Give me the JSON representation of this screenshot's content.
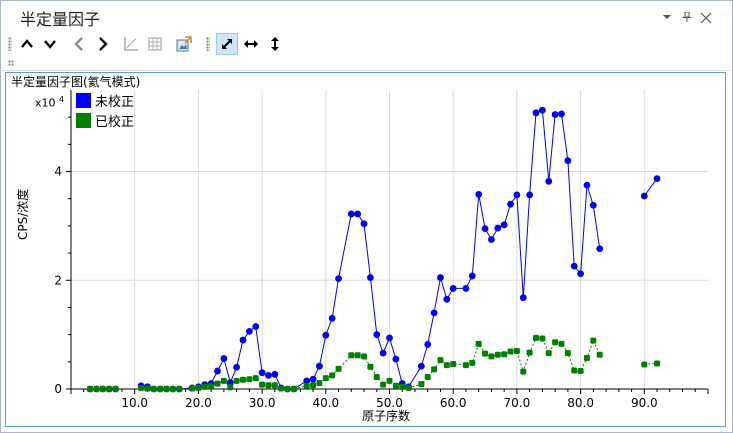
{
  "window": {
    "title": "半定量因子",
    "controls": [
      "dropdown-icon",
      "pin-icon",
      "close-icon"
    ]
  },
  "toolbar": {
    "buttons": [
      {
        "name": "collapse-up-button",
        "icon": "chevron-up-icon",
        "active": false
      },
      {
        "name": "expand-down-button",
        "icon": "chevron-down-icon",
        "active": false
      },
      {
        "name": "previous-button",
        "icon": "chevron-left-icon",
        "active": false
      },
      {
        "name": "next-button",
        "icon": "chevron-right-icon",
        "active": false
      },
      {
        "name": "chart-settings-button",
        "icon": "chart-axis-icon",
        "active": false
      },
      {
        "name": "table-button",
        "icon": "table-grid-icon",
        "active": false
      },
      {
        "name": "export-button",
        "icon": "export-image-icon",
        "active": false
      },
      {
        "name": "fit-all-button",
        "icon": "diagonal-arrows-icon",
        "active": true
      },
      {
        "name": "fit-horizontal-button",
        "icon": "horizontal-arrows-icon",
        "active": false
      },
      {
        "name": "fit-vertical-button",
        "icon": "vertical-arrows-icon",
        "active": false
      }
    ]
  },
  "chart_data": {
    "type": "line",
    "title": "半定量因子图(氦气模式)",
    "xlabel": "原子序数",
    "ylabel": "CPS/浓度",
    "y_multiplier": "x10",
    "y_multiplier_exp": "4",
    "xlim": [
      0,
      100
    ],
    "ylim": [
      0,
      5.5
    ],
    "x_ticks": [
      10,
      20,
      30,
      40,
      50,
      60,
      70,
      80,
      90
    ],
    "x_tick_labels": [
      "10.0",
      "20.0",
      "30.0",
      "40.0",
      "50.0",
      "60.0",
      "70.0",
      "80.0",
      "90.0"
    ],
    "y_ticks": [
      0,
      2,
      4
    ],
    "y_tick_labels": [
      "0",
      "2",
      "4"
    ],
    "grid": true,
    "legend_position": "top-left",
    "series": [
      {
        "name": "未校正",
        "color": "#0000ff",
        "points": [
          [
            3,
            0
          ],
          [
            4,
            0
          ],
          [
            5,
            0
          ],
          [
            6,
            0
          ],
          [
            7,
            0
          ],
          [
            11,
            0.06
          ],
          [
            12,
            0.04
          ],
          [
            13,
            0
          ],
          [
            14,
            0
          ],
          [
            15,
            0
          ],
          [
            16,
            0
          ],
          [
            17,
            0
          ],
          [
            19,
            0.02
          ],
          [
            20,
            0.04
          ],
          [
            21,
            0.08
          ],
          [
            22,
            0.1
          ],
          [
            23,
            0.33
          ],
          [
            24,
            0.56
          ],
          [
            25,
            0.12
          ],
          [
            26,
            0.4
          ],
          [
            27,
            0.9
          ],
          [
            28,
            1.06
          ],
          [
            29,
            1.15
          ],
          [
            30,
            0.3
          ],
          [
            31,
            0.25
          ],
          [
            32,
            0.27
          ],
          [
            33,
            0.02
          ],
          [
            34,
            0
          ],
          [
            35,
            0
          ],
          [
            37,
            0.15
          ],
          [
            38,
            0.18
          ],
          [
            39,
            0.42
          ],
          [
            40,
            0.99
          ],
          [
            41,
            1.3
          ],
          [
            42,
            2.03
          ],
          [
            44,
            3.22
          ],
          [
            45,
            3.22
          ],
          [
            46,
            3.04
          ],
          [
            47,
            2.05
          ],
          [
            48,
            1.0
          ],
          [
            49,
            0.66
          ],
          [
            50,
            0.94
          ],
          [
            51,
            0.55
          ],
          [
            52,
            0.1
          ],
          [
            53,
            0.04
          ],
          [
            55,
            0.42
          ],
          [
            56,
            0.82
          ],
          [
            57,
            1.4
          ],
          [
            58,
            2.05
          ],
          [
            59,
            1.65
          ],
          [
            60,
            1.85
          ],
          [
            62,
            1.85
          ],
          [
            63,
            2.08
          ],
          [
            64,
            3.58
          ],
          [
            65,
            2.95
          ],
          [
            66,
            2.75
          ],
          [
            67,
            2.96
          ],
          [
            68,
            3.02
          ],
          [
            69,
            3.4
          ],
          [
            70,
            3.57
          ],
          [
            71,
            1.68
          ],
          [
            72,
            3.57
          ],
          [
            73,
            5.08
          ],
          [
            74,
            5.13
          ],
          [
            75,
            3.82
          ],
          [
            76,
            5.05
          ],
          [
            77,
            5.06
          ],
          [
            78,
            4.2
          ],
          [
            79,
            2.26
          ],
          [
            80,
            2.12
          ],
          [
            81,
            3.75
          ],
          [
            82,
            3.38
          ],
          [
            83,
            2.58
          ],
          [
            90,
            3.55
          ],
          [
            92,
            3.87
          ]
        ]
      },
      {
        "name": "已校正",
        "color": "#008000",
        "points": [
          [
            3,
            0
          ],
          [
            4,
            0
          ],
          [
            5,
            0
          ],
          [
            6,
            0
          ],
          [
            7,
            0
          ],
          [
            11,
            0.02
          ],
          [
            12,
            0.01
          ],
          [
            13,
            0
          ],
          [
            14,
            0
          ],
          [
            15,
            0
          ],
          [
            16,
            0
          ],
          [
            17,
            0
          ],
          [
            19,
            0.01
          ],
          [
            20,
            0.02
          ],
          [
            21,
            0.04
          ],
          [
            22,
            0.05
          ],
          [
            23,
            0.1
          ],
          [
            24,
            0.15
          ],
          [
            25,
            0.03
          ],
          [
            26,
            0.15
          ],
          [
            27,
            0.17
          ],
          [
            28,
            0.18
          ],
          [
            29,
            0.2
          ],
          [
            30,
            0.08
          ],
          [
            31,
            0.07
          ],
          [
            32,
            0.07
          ],
          [
            33,
            0.01
          ],
          [
            34,
            0
          ],
          [
            35,
            0
          ],
          [
            37,
            0.06
          ],
          [
            38,
            0.07
          ],
          [
            39,
            0.11
          ],
          [
            40,
            0.2
          ],
          [
            41,
            0.25
          ],
          [
            42,
            0.37
          ],
          [
            44,
            0.62
          ],
          [
            45,
            0.62
          ],
          [
            46,
            0.6
          ],
          [
            47,
            0.41
          ],
          [
            48,
            0.22
          ],
          [
            49,
            0.08
          ],
          [
            50,
            0.15
          ],
          [
            51,
            0.06
          ],
          [
            52,
            0.04
          ],
          [
            53,
            0.02
          ],
          [
            55,
            0.09
          ],
          [
            56,
            0.22
          ],
          [
            57,
            0.36
          ],
          [
            58,
            0.53
          ],
          [
            59,
            0.44
          ],
          [
            60,
            0.46
          ],
          [
            62,
            0.44
          ],
          [
            63,
            0.48
          ],
          [
            64,
            0.83
          ],
          [
            65,
            0.65
          ],
          [
            66,
            0.6
          ],
          [
            67,
            0.63
          ],
          [
            68,
            0.64
          ],
          [
            69,
            0.69
          ],
          [
            70,
            0.7
          ],
          [
            71,
            0.32
          ],
          [
            72,
            0.67
          ],
          [
            73,
            0.94
          ],
          [
            74,
            0.93
          ],
          [
            75,
            0.66
          ],
          [
            76,
            0.86
          ],
          [
            77,
            0.83
          ],
          [
            78,
            0.66
          ],
          [
            79,
            0.34
          ],
          [
            80,
            0.33
          ],
          [
            81,
            0.57
          ],
          [
            82,
            0.89
          ],
          [
            83,
            0.63
          ],
          [
            90,
            0.45
          ],
          [
            92,
            0.47
          ]
        ]
      }
    ]
  }
}
